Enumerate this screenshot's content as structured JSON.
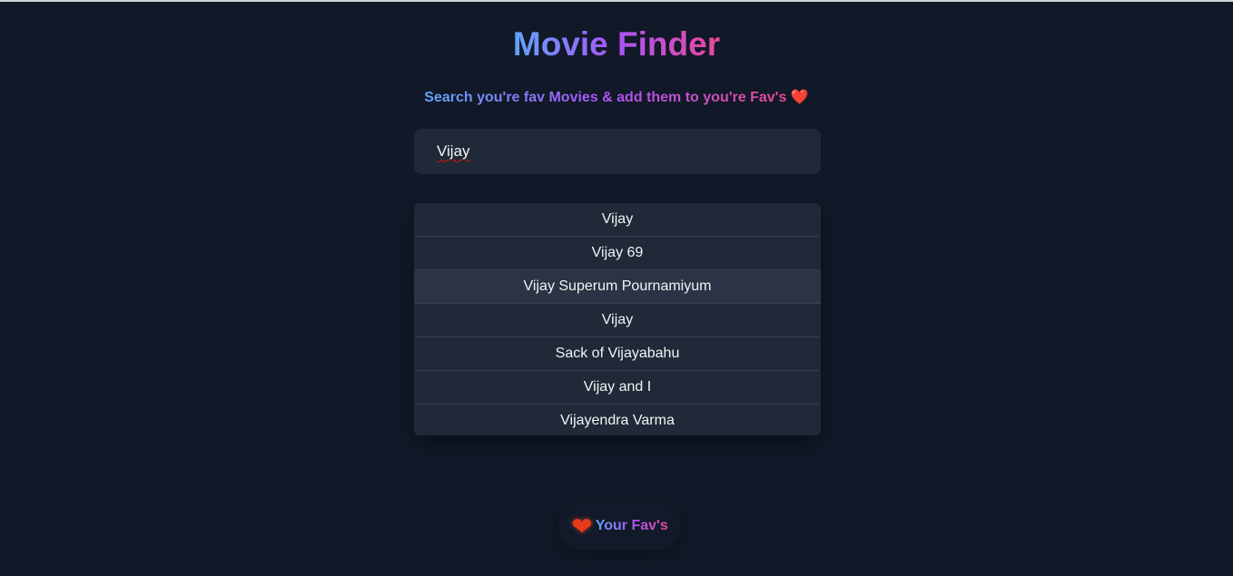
{
  "header": {
    "title": "Movie Finder",
    "subtitle": "Search you're fav Movies & add them to you're Fav's",
    "subtitle_icon": "❤️"
  },
  "search": {
    "value": "Vijay"
  },
  "results": [
    {
      "title": "Vijay"
    },
    {
      "title": "Vijay 69"
    },
    {
      "title": "Vijay Superum Pournamiyum"
    },
    {
      "title": "Vijay"
    },
    {
      "title": "Sack of Vijayabahu"
    },
    {
      "title": "Vijay and I"
    },
    {
      "title": "Vijayendra Varma"
    }
  ],
  "favorites_button": {
    "icon": "❤",
    "label": "Your Fav's"
  },
  "colors": {
    "background": "#111827",
    "panel": "#1f2937",
    "gradient": [
      "#60a5fa",
      "#a855f7",
      "#ec4899"
    ]
  }
}
